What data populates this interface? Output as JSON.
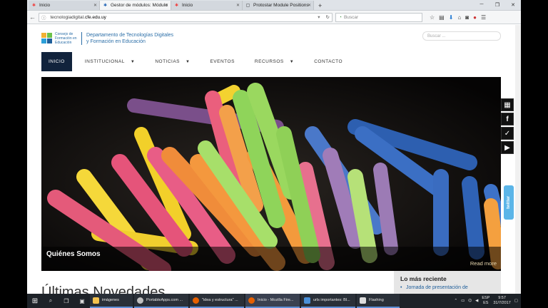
{
  "browser": {
    "tabs": [
      {
        "label": "Inicio",
        "active": false
      },
      {
        "label": "Gestor de módulos: Módulo",
        "active": true
      },
      {
        "label": "Inicio",
        "active": false
      },
      {
        "label": "Protostar Module Positions",
        "active": false
      }
    ],
    "url_prefix": "tecnologiadigital.",
    "url_domain": "cfe.edu.uy",
    "search_placeholder": "Buscar"
  },
  "site": {
    "logo_small": "Consejo de Formación en Educación",
    "logo_title_line1": "Departamento de Tecnologías Digitales",
    "logo_title_line2": "y Formación en Educación",
    "search_placeholder": "Buscar ..."
  },
  "menu": [
    {
      "label": "INICIO",
      "active": true,
      "caret": false
    },
    {
      "label": "INSTITUCIONAL",
      "active": false,
      "caret": true
    },
    {
      "label": "NOTICIAS",
      "active": false,
      "caret": true
    },
    {
      "label": "EVENTOS",
      "active": false,
      "caret": false
    },
    {
      "label": "RECURSOS",
      "active": false,
      "caret": true
    },
    {
      "label": "CONTACTO",
      "active": false,
      "caret": false
    }
  ],
  "hero": {
    "title": "Quiénes Somos",
    "more": "Read more"
  },
  "latest": {
    "title": "Últimas Novedades"
  },
  "sidebar": {
    "title": "Lo más reciente",
    "items": [
      "Jornada de presentación de"
    ]
  },
  "twitter_tab": "twitter",
  "taskbar": {
    "apps": [
      {
        "label": "imágenes",
        "color": "#f2c14e"
      },
      {
        "label": "PortableApps.com ...",
        "color": "#c0c0c0"
      },
      {
        "label": "\"idea y estructura\" ...",
        "color": "#e66000"
      },
      {
        "label": "Inicio - Mozilla Fire...",
        "color": "#e66000"
      },
      {
        "label": "urls importantes: Bl...",
        "color": "#4a90d9"
      },
      {
        "label": "Flashing",
        "color": "#dddddd"
      }
    ],
    "lang_top": "ESP",
    "lang_bottom": "ES",
    "time": "9:57",
    "date": "31/7/2017"
  },
  "colors": {
    "menu_active": "#11233c",
    "brand_blue": "#2c6fa8",
    "twitter": "#5bb5e8"
  }
}
